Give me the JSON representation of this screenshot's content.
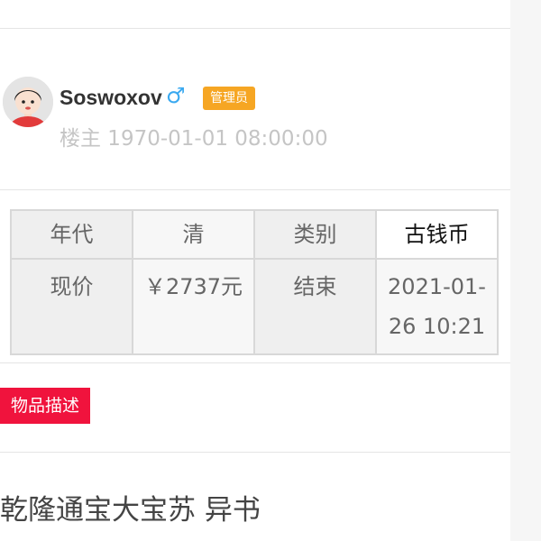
{
  "author": {
    "name": "Soswoxov",
    "gender_icon": "male-icon",
    "gender_glyph": "♂",
    "gender_color": "#3aa9f0",
    "badge": "管理员",
    "badge_color": "#f6a623",
    "meta": "楼主 1970-01-01 08:00:00"
  },
  "info_table": {
    "era_label": "年代",
    "era_value": "清",
    "category_label": "类别",
    "category_value": "古钱币",
    "price_label": "现价",
    "price_value": "￥2737元",
    "end_label": "结束",
    "end_value": "2021-01-26 10:21"
  },
  "description_tag": {
    "label": "物品描述",
    "color": "#f0133d"
  },
  "item_title": "乾隆通宝大宝苏 异书"
}
